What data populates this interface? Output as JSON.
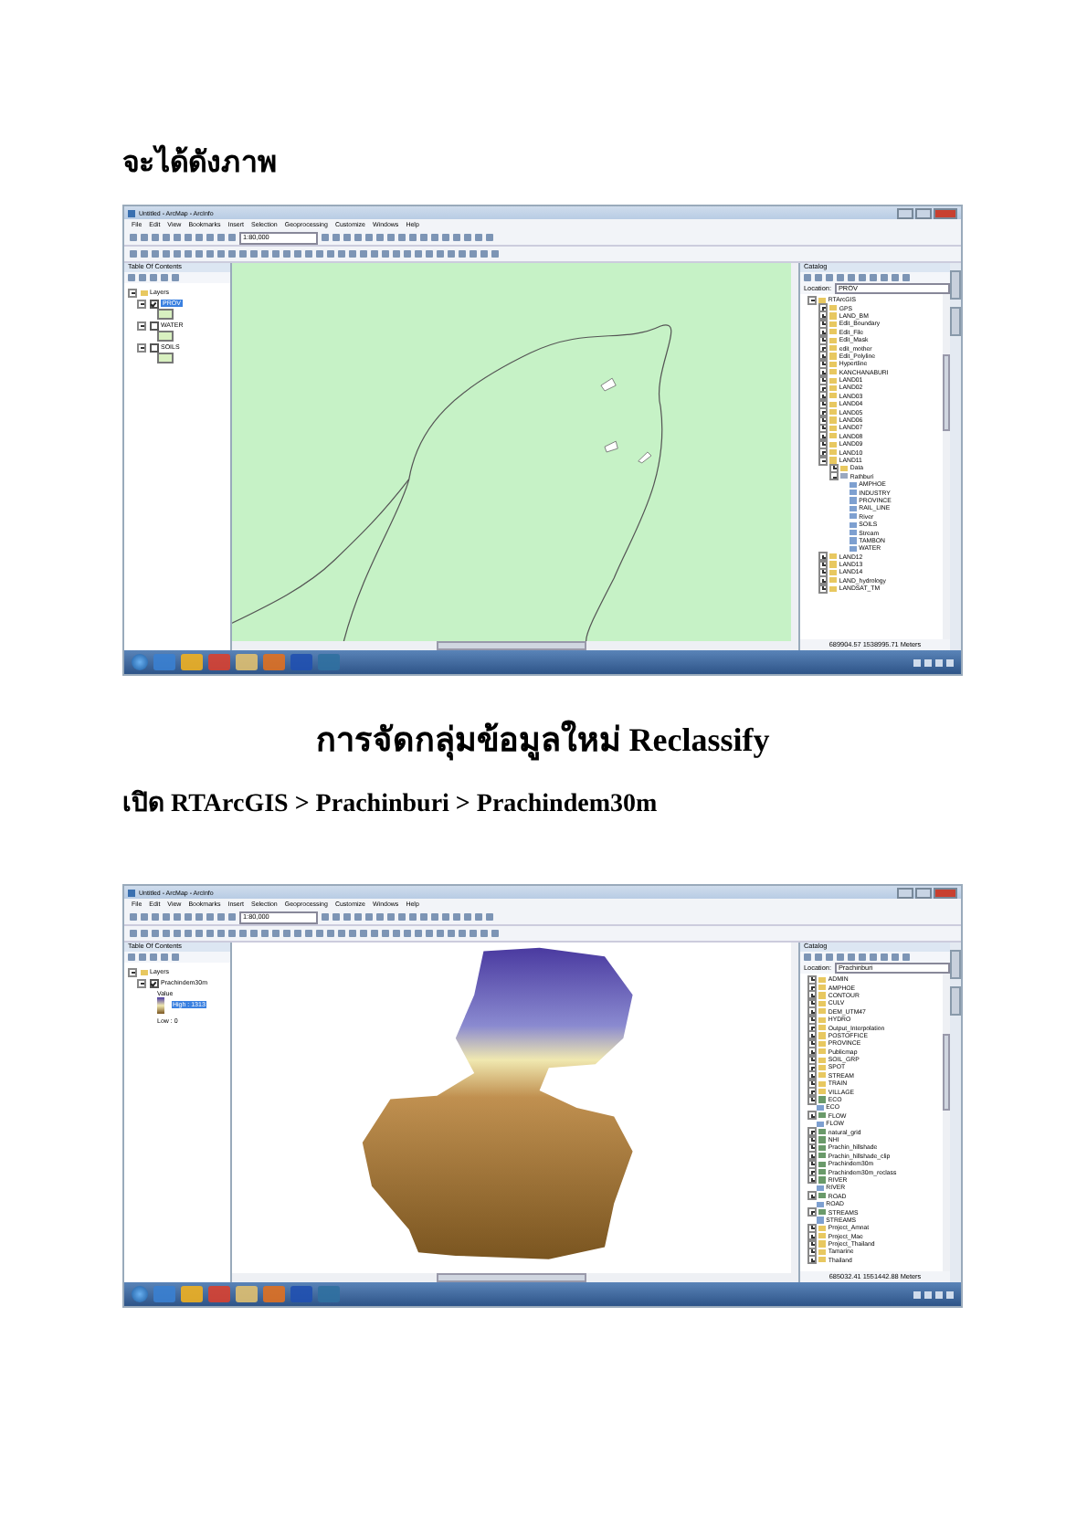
{
  "heading": "จะได้ดังภาพ",
  "screenshots": [
    {
      "title": "Untitled - ArcMap - ArcInfo",
      "menu": [
        "File",
        "Edit",
        "View",
        "Bookmarks",
        "Insert",
        "Selection",
        "Geoprocessing",
        "Customize",
        "Windows",
        "Help"
      ],
      "scale": "1:80,000",
      "toc_title": "Table Of Contents",
      "layers": [
        {
          "name": "Layers",
          "expanded": true,
          "children": [
            {
              "name": "PROV",
              "kind": "layer",
              "checked": true,
              "selected": true
            },
            {
              "name": "WATER",
              "kind": "layer",
              "checked": false,
              "selected": false
            },
            {
              "name": "SOILS",
              "kind": "layer",
              "checked": false,
              "selected": false
            }
          ]
        }
      ],
      "catalog_title": "Catalog",
      "location_label": "Location:",
      "location": "PROV",
      "catalog": [
        {
          "name": "RTArcGIS",
          "kind": "folder",
          "expanded": true,
          "children": [
            {
              "name": "GPS",
              "kind": "folder",
              "expanded": false
            },
            {
              "name": "LAND_BM",
              "kind": "folder",
              "expanded": false
            },
            {
              "name": "Edit_Boundary",
              "kind": "folder",
              "expanded": false
            },
            {
              "name": "Edit_File",
              "kind": "folder",
              "expanded": false
            },
            {
              "name": "Edit_Mask",
              "kind": "folder",
              "expanded": false
            },
            {
              "name": "edit_mother",
              "kind": "folder",
              "expanded": false
            },
            {
              "name": "Edit_Polyline",
              "kind": "folder",
              "expanded": false
            },
            {
              "name": "Hypertline",
              "kind": "folder",
              "expanded": false
            },
            {
              "name": "KANCHANABURI",
              "kind": "folder",
              "expanded": false
            },
            {
              "name": "LAND01",
              "kind": "folder",
              "expanded": false
            },
            {
              "name": "LAND02",
              "kind": "folder",
              "expanded": false
            },
            {
              "name": "LAND03",
              "kind": "folder",
              "expanded": false
            },
            {
              "name": "LAND04",
              "kind": "folder",
              "expanded": false
            },
            {
              "name": "LAND05",
              "kind": "folder",
              "expanded": false
            },
            {
              "name": "LAND06",
              "kind": "folder",
              "expanded": false
            },
            {
              "name": "LAND07",
              "kind": "folder",
              "expanded": false
            },
            {
              "name": "LAND08",
              "kind": "folder",
              "expanded": false
            },
            {
              "name": "LAND09",
              "kind": "folder",
              "expanded": false
            },
            {
              "name": "LAND10",
              "kind": "folder",
              "expanded": false
            },
            {
              "name": "LAND11",
              "kind": "folder",
              "expanded": true,
              "children": [
                {
                  "name": "Data",
                  "kind": "folder",
                  "expanded": false
                },
                {
                  "name": "Rathburi",
                  "kind": "gdb",
                  "expanded": true,
                  "children": [
                    {
                      "name": "AMPHOE",
                      "kind": "shape"
                    },
                    {
                      "name": "INDUSTRY",
                      "kind": "shape"
                    },
                    {
                      "name": "PROVINCE",
                      "kind": "shape"
                    },
                    {
                      "name": "RAIL_LINE",
                      "kind": "shape"
                    },
                    {
                      "name": "River",
                      "kind": "shape"
                    },
                    {
                      "name": "SOILS",
                      "kind": "shape"
                    },
                    {
                      "name": "Stream",
                      "kind": "shape"
                    },
                    {
                      "name": "TAMBON",
                      "kind": "shape"
                    },
                    {
                      "name": "WATER",
                      "kind": "shape"
                    }
                  ]
                }
              ]
            },
            {
              "name": "LAND12",
              "kind": "folder",
              "expanded": false
            },
            {
              "name": "LAND13",
              "kind": "folder",
              "expanded": false
            },
            {
              "name": "LAND14",
              "kind": "folder",
              "expanded": false
            },
            {
              "name": "LAND_hydrology",
              "kind": "folder",
              "expanded": false
            },
            {
              "name": "LANDSAT_TM",
              "kind": "folder",
              "expanded": false
            }
          ]
        }
      ],
      "map": {
        "kind": "vector"
      },
      "status": "689904.57  1538995.71 Meters"
    },
    {
      "title": "Untitled - ArcMap - ArcInfo",
      "menu": [
        "File",
        "Edit",
        "View",
        "Bookmarks",
        "Insert",
        "Selection",
        "Geoprocessing",
        "Customize",
        "Windows",
        "Help"
      ],
      "scale": "1:80,000",
      "toc_title": "Table Of Contents",
      "layers": [
        {
          "name": "Layers",
          "expanded": true,
          "children": [
            {
              "name": "Prachindem30m",
              "kind": "raster",
              "checked": true,
              "selected": false,
              "value_label": "Value",
              "high": "High : 1313",
              "low": "Low : 0"
            }
          ]
        }
      ],
      "catalog_title": "Catalog",
      "location_label": "Location:",
      "location": "Prachinburi",
      "catalog": [
        {
          "name": "ADMIN",
          "kind": "folder",
          "expanded": false
        },
        {
          "name": "AMPHOE",
          "kind": "folder",
          "expanded": false
        },
        {
          "name": "CONTOUR",
          "kind": "folder",
          "expanded": false
        },
        {
          "name": "CULV",
          "kind": "folder",
          "expanded": false
        },
        {
          "name": "DEM_UTM47",
          "kind": "folder",
          "expanded": false
        },
        {
          "name": "HYDRO",
          "kind": "folder",
          "expanded": false
        },
        {
          "name": "Output_Interpolation",
          "kind": "folder",
          "expanded": false
        },
        {
          "name": "POSTOFFICE",
          "kind": "folder",
          "expanded": false
        },
        {
          "name": "PROVINCE",
          "kind": "folder",
          "expanded": false
        },
        {
          "name": "Publicmap",
          "kind": "folder",
          "expanded": false
        },
        {
          "name": "SOIL_GRP",
          "kind": "folder",
          "expanded": false
        },
        {
          "name": "SPOT",
          "kind": "folder",
          "expanded": false
        },
        {
          "name": "STREAM",
          "kind": "folder",
          "expanded": false
        },
        {
          "name": "TRAIN",
          "kind": "folder",
          "expanded": false
        },
        {
          "name": "VILLAGE",
          "kind": "folder",
          "expanded": false
        },
        {
          "name": "ECO",
          "kind": "raster",
          "expanded": false
        },
        {
          "name": "ECO",
          "kind": "shape"
        },
        {
          "name": "FLOW",
          "kind": "raster",
          "expanded": false
        },
        {
          "name": "FLOW",
          "kind": "shape"
        },
        {
          "name": "natural_grid",
          "kind": "raster",
          "expanded": false
        },
        {
          "name": "NHI",
          "kind": "raster",
          "expanded": false
        },
        {
          "name": "Prachin_hillshade",
          "kind": "raster",
          "expanded": false
        },
        {
          "name": "Prachin_hillshade_clip",
          "kind": "raster",
          "expanded": false
        },
        {
          "name": "Prachindem30m",
          "kind": "raster",
          "expanded": false
        },
        {
          "name": "Prachindem30m_reclass",
          "kind": "raster",
          "expanded": false
        },
        {
          "name": "RIVER",
          "kind": "raster",
          "expanded": false
        },
        {
          "name": "RIVER",
          "kind": "shape"
        },
        {
          "name": "ROAD",
          "kind": "raster",
          "expanded": false
        },
        {
          "name": "ROAD",
          "kind": "shape"
        },
        {
          "name": "STREAMS",
          "kind": "raster",
          "expanded": false
        },
        {
          "name": "STREAMS",
          "kind": "shape"
        },
        {
          "name": "Project_Amnat",
          "kind": "folder",
          "expanded": false
        },
        {
          "name": "Project_Mae",
          "kind": "folder",
          "expanded": false
        },
        {
          "name": "Project_Thailand",
          "kind": "folder",
          "expanded": false
        },
        {
          "name": "Tamarine",
          "kind": "folder",
          "expanded": false
        },
        {
          "name": "Thailand",
          "kind": "folder",
          "expanded": false
        }
      ],
      "map": {
        "kind": "raster"
      },
      "status": "685032.41  1551442.88 Meters"
    }
  ],
  "section_title": "การจัดกลุ่มข้อมูลใหม่ Reclassify",
  "instruction": "เปิด RTArcGIS > Prachinburi > Prachindem30m"
}
